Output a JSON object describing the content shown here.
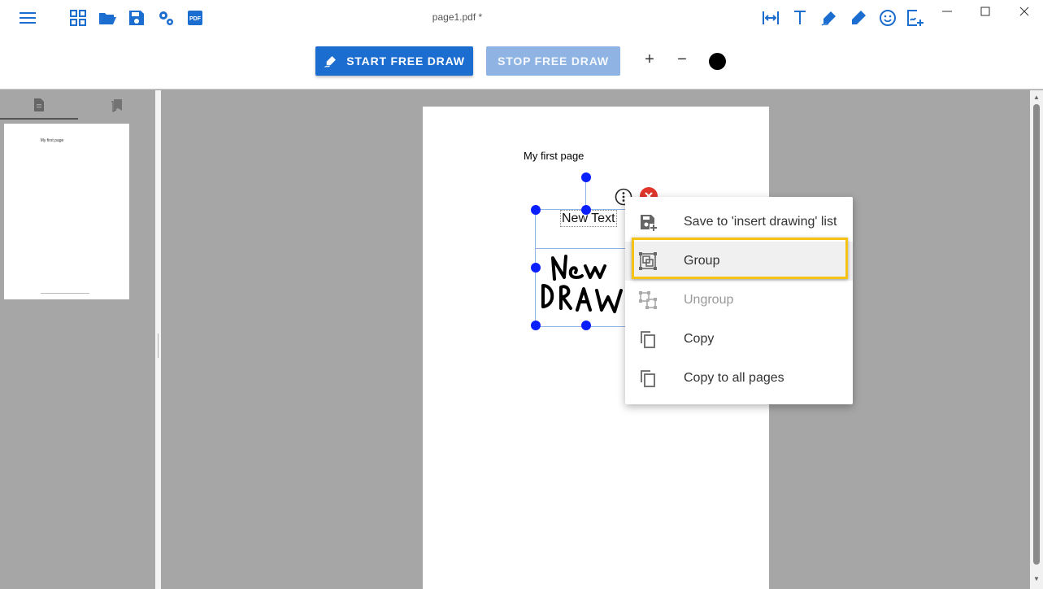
{
  "window": {
    "title": "page1.pdf *"
  },
  "toolbar": {
    "start_free_draw_label": "START FREE DRAW",
    "stop_free_draw_label": "STOP FREE DRAW",
    "zoom_in_label": "+",
    "zoom_out_label": "−",
    "pen_color": "#000000",
    "accent_color": "#1c6dd0",
    "left_icons": [
      "menu-icon",
      "grid-icon",
      "folder-open-icon",
      "save-icon",
      "settings-icon",
      "pdf-icon"
    ],
    "right_icons": [
      "fit-width-icon",
      "text-icon",
      "signature-icon",
      "pen-icon",
      "emoji-icon",
      "insert-drawing-icon"
    ]
  },
  "sidebar": {
    "tabs": [
      "pages-icon",
      "bookmarks-icon"
    ],
    "thumbnail_title": "My first page"
  },
  "page": {
    "title": "My first page",
    "text_element": "New Text"
  },
  "context_menu": {
    "items": [
      {
        "label": "Save to 'insert drawing' list",
        "icon": "save-plus-icon",
        "enabled": true
      },
      {
        "label": "Group",
        "icon": "group-icon",
        "enabled": true,
        "highlighted": true
      },
      {
        "label": "Ungroup",
        "icon": "ungroup-icon",
        "enabled": false
      },
      {
        "label": "Copy",
        "icon": "copy-icon",
        "enabled": true
      },
      {
        "label": "Copy to all pages",
        "icon": "copy-all-icon",
        "enabled": true
      }
    ],
    "highlight_color": "#f5c314"
  }
}
